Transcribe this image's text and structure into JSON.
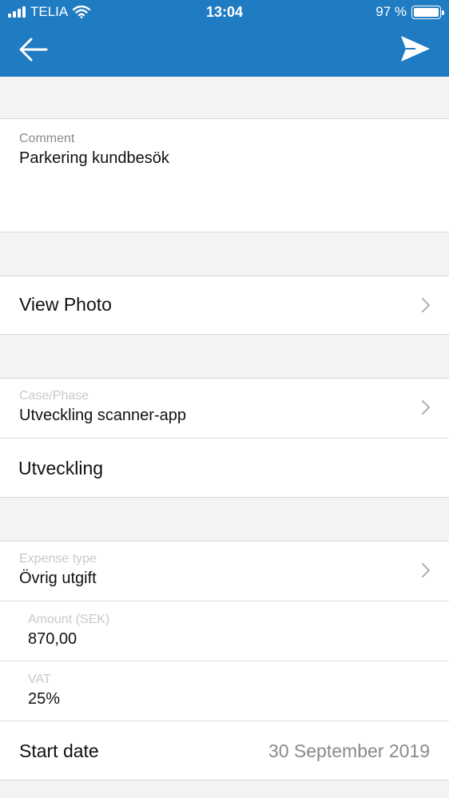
{
  "status_bar": {
    "carrier": "TELIA",
    "time": "13:04",
    "battery": "97 %",
    "battery_level": 0.97
  },
  "nav": {
    "back_icon": "arrow-left-icon",
    "send_icon": "send-icon"
  },
  "comment": {
    "label": "Comment",
    "value": "Parkering kundbesök"
  },
  "view_photo": {
    "label": "View Photo"
  },
  "case_phase": {
    "label": "Case/Phase",
    "value": "Utveckling scanner-app",
    "phase": "Utveckling"
  },
  "expense": {
    "type_label": "Expense type",
    "type_value": "Övrig utgift",
    "amount_label": "Amount (SEK)",
    "amount_value": "870,00",
    "vat_label": "VAT",
    "vat_value": "25%",
    "start_date_label": "Start date",
    "start_date_value": "30 September 2019"
  },
  "colors": {
    "accent": "#1f7bc2",
    "background": "#f3f3f3"
  }
}
